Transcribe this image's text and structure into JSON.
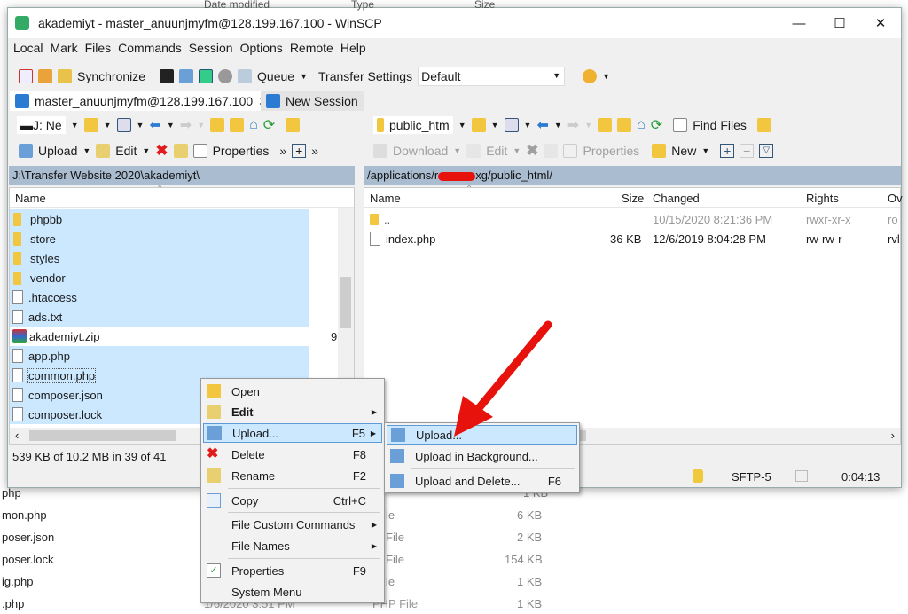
{
  "background": {
    "headers": [
      "Date modified",
      "Type",
      "Size"
    ],
    "rows": [
      {
        "name": "php",
        "type": "",
        "size": "1 KB"
      },
      {
        "name": "mon.php",
        "type": "le",
        "size": "6 KB"
      },
      {
        "name": "poser.json",
        "type": "File",
        "size": "2 KB"
      },
      {
        "name": "poser.lock",
        "type": "File",
        "size": "154 KB"
      },
      {
        "name": "ig.php",
        "type": "le",
        "size": "1 KB"
      },
      {
        "name": ".php",
        "date": "1/6/2020 3:51 PM",
        "type": "PHP File",
        "size": "1 KB"
      }
    ]
  },
  "window": {
    "title": "akademiyt - master_anuunjmyfm@128.199.167.100 - WinSCP"
  },
  "menu": [
    "Local",
    "Mark",
    "Files",
    "Commands",
    "Session",
    "Options",
    "Remote",
    "Help"
  ],
  "toolbar": {
    "synchronize": "Synchronize",
    "queue": "Queue",
    "transfer_settings": "Transfer Settings",
    "transfer_value": "Default"
  },
  "tabs": [
    {
      "label": "master_anuunjmyfm@128.199.167.100"
    },
    {
      "label": "New Session"
    }
  ],
  "left": {
    "drive": "J: Ne",
    "actions": {
      "upload": "Upload",
      "edit": "Edit",
      "properties": "Properties"
    },
    "path": "J:\\Transfer Website 2020\\akademiyt\\",
    "header": {
      "name": "Name"
    },
    "rows": [
      {
        "name": "phpbb",
        "type": "folder",
        "selected": true
      },
      {
        "name": "store",
        "type": "folder",
        "selected": true
      },
      {
        "name": "styles",
        "type": "folder",
        "selected": true
      },
      {
        "name": "vendor",
        "type": "folder",
        "selected": true
      },
      {
        "name": ".htaccess",
        "type": "file",
        "selected": true
      },
      {
        "name": "ads.txt",
        "type": "file",
        "selected": true
      },
      {
        "name": "akademiyt.zip",
        "type": "zip",
        "selected": false,
        "size": "9"
      },
      {
        "name": "app.php",
        "type": "file",
        "selected": true
      },
      {
        "name": "common.php",
        "type": "file",
        "selected": true
      },
      {
        "name": "composer.json",
        "type": "file",
        "selected": true
      },
      {
        "name": "composer.lock",
        "type": "file",
        "selected": true
      }
    ],
    "status": "539 KB of 10.2 MB in 39 of 41"
  },
  "right": {
    "folder": "public_htm",
    "actions": {
      "download": "Download",
      "edit": "Edit",
      "properties": "Properties",
      "new": "New",
      "find": "Find Files"
    },
    "path_prefix": "/applications/r",
    "path_suffix": "xg/public_html/",
    "header": {
      "name": "Name",
      "size": "Size",
      "changed": "Changed",
      "rights": "Rights",
      "owner": "Ov"
    },
    "rows": [
      {
        "name": "..",
        "size": "",
        "changed": "10/15/2020 8:21:36 PM",
        "rights": "rwxr-xr-x",
        "owner": "ro"
      },
      {
        "name": "index.php",
        "size": "36 KB",
        "changed": "12/6/2019 8:04:28 PM",
        "rights": "rw-rw-r--",
        "owner": "rvl"
      }
    ]
  },
  "statusbar": {
    "protocol": "SFTP-5",
    "time": "0:04:13"
  },
  "context_menu": [
    {
      "label": "Open",
      "shortcut": ""
    },
    {
      "label": "Edit",
      "shortcut": "",
      "bold": true
    },
    {
      "label": "Upload...",
      "shortcut": "F5"
    },
    {
      "label": "Delete",
      "shortcut": "F8"
    },
    {
      "label": "Rename",
      "shortcut": "F2"
    },
    {
      "label": "Copy",
      "shortcut": "Ctrl+C"
    },
    {
      "label": "File Custom Commands",
      "shortcut": ""
    },
    {
      "label": "File Names",
      "shortcut": ""
    },
    {
      "label": "Properties",
      "shortcut": "F9"
    },
    {
      "label": "System Menu",
      "shortcut": ""
    }
  ],
  "submenu": [
    {
      "label": "Upload...",
      "shortcut": ""
    },
    {
      "label": "Upload in Background...",
      "shortcut": ""
    },
    {
      "label": "Upload and Delete...",
      "shortcut": "F6"
    }
  ],
  "colors": {
    "selection": "#cce8ff",
    "path_bar": "#a9bcd0",
    "arrow": "#e8120c"
  }
}
